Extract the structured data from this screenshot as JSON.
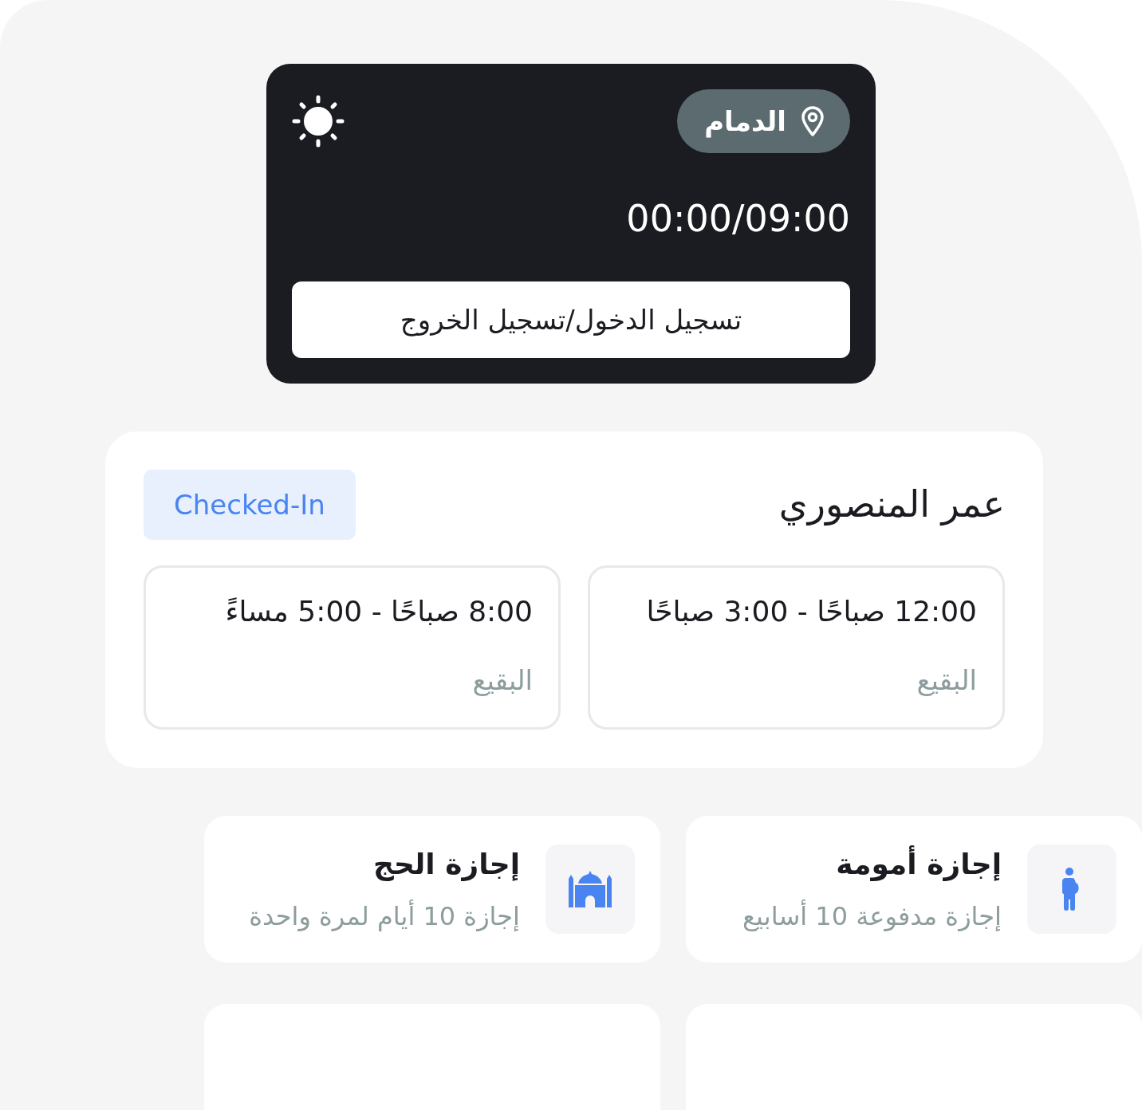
{
  "header": {
    "location": "الدمام",
    "timer": "00:00/09:00",
    "button": "تسجيل الدخول/تسجيل الخروج"
  },
  "employee": {
    "name": "عمر المنصوري",
    "status": "Checked-In",
    "shifts": [
      {
        "time": "12:00 صباحًا - 3:00 صباحًا",
        "place": "البقيع"
      },
      {
        "time": "8:00 صباحًا - 5:00 مساءً",
        "place": "البقيع"
      }
    ]
  },
  "leaves": [
    {
      "kind": "maternity",
      "title": "إجازة أمومة",
      "subtitle": "إجازة مدفوعة 10 أسابيع"
    },
    {
      "kind": "hajj",
      "title": "إجازة الحج",
      "subtitle": "إجازة 10 أيام لمرة واحدة"
    }
  ],
  "blank_cards": [
    {
      "kind": "blank"
    },
    {
      "kind": "blank"
    }
  ]
}
